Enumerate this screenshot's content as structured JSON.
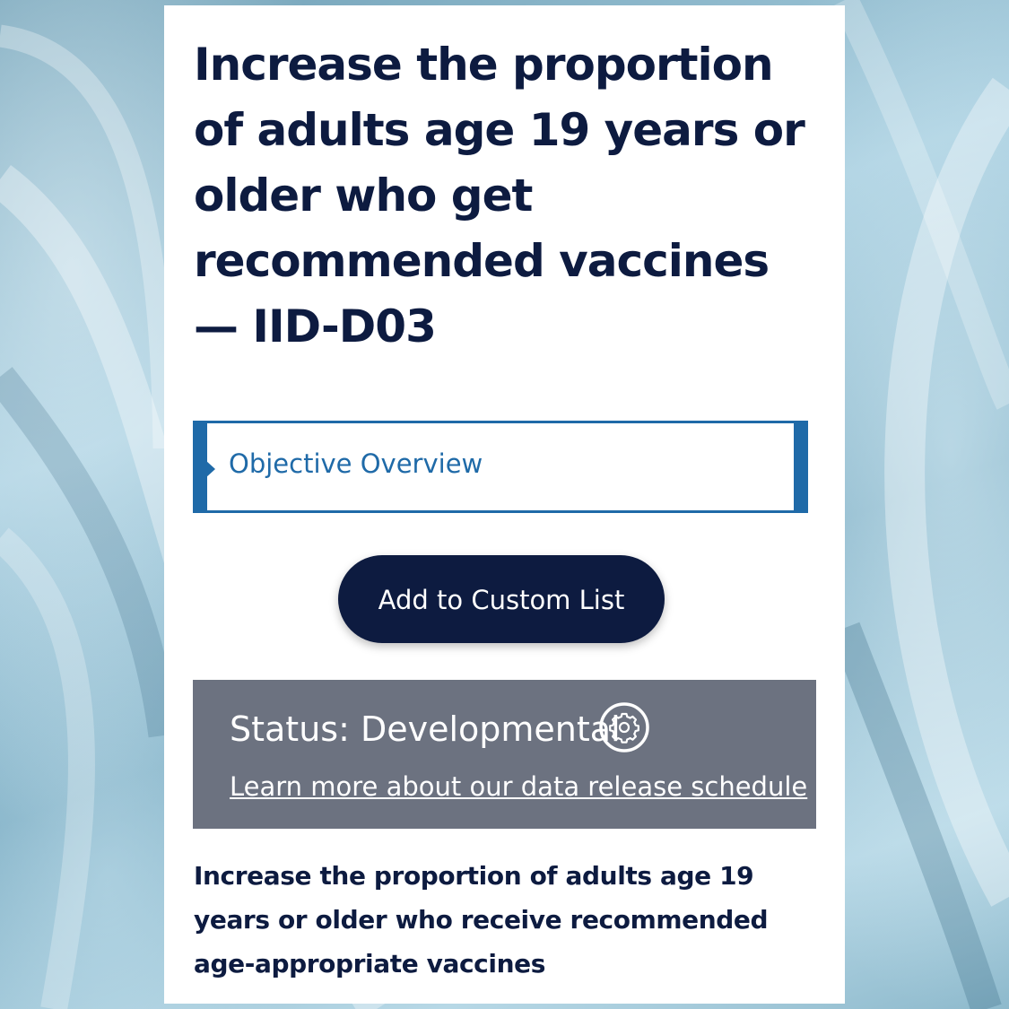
{
  "page": {
    "title": "Increase the proportion of adults age 19 years or older who get recommended vaccines — IID-D03",
    "overview_label": "Objective Overview",
    "add_button_label": "Add to Custom List",
    "status": {
      "text": "Status: Developmental",
      "icon": "gear-icon",
      "link_text": "Learn more about our data release schedule"
    },
    "description": "Increase the proportion of adults age 19 years or older who receive recommended age-appropriate vaccines"
  },
  "colors": {
    "navy": "#0d1b40",
    "accent_blue": "#1f6aa8",
    "status_gray": "#6c7280",
    "background_blue": "#8fb9cc"
  }
}
